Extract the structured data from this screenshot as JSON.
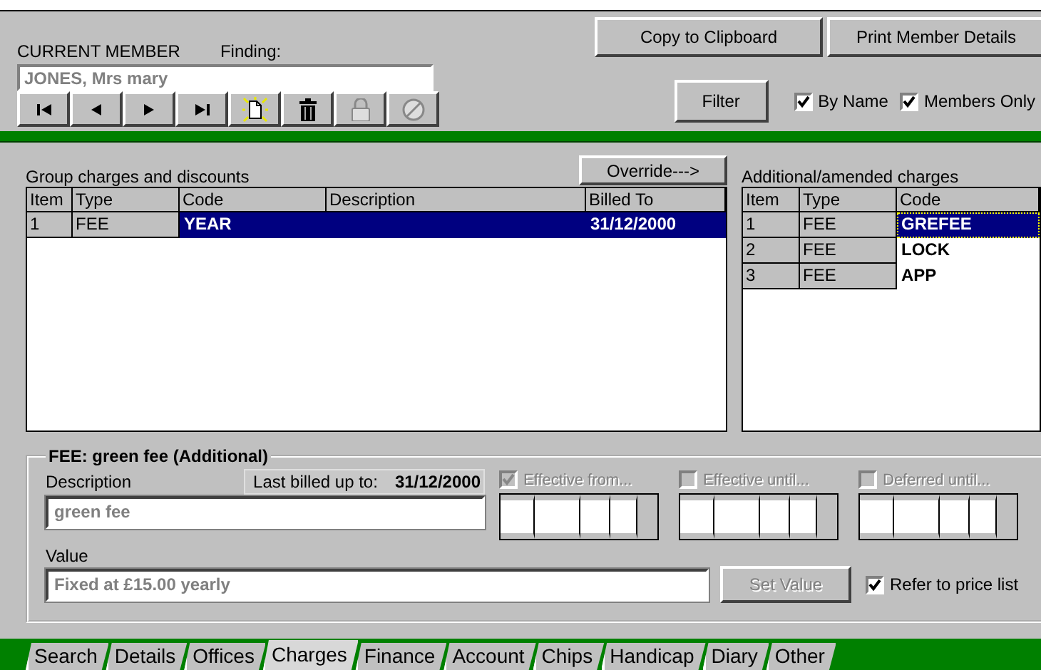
{
  "member": {
    "label": "CURRENT MEMBER",
    "finding_label": "Finding:",
    "name": "JONES, Mrs mary"
  },
  "nav_buttons": [
    {
      "kind": "first",
      "disabled": false
    },
    {
      "kind": "prev",
      "disabled": false
    },
    {
      "kind": "next",
      "disabled": false
    },
    {
      "kind": "last",
      "disabled": false
    },
    {
      "kind": "new",
      "disabled": false
    },
    {
      "kind": "delete",
      "disabled": false
    },
    {
      "kind": "lock",
      "disabled": true
    },
    {
      "kind": "cancel",
      "disabled": true
    }
  ],
  "header_buttons": [
    "Copy to Clipboard",
    "Print Member Details"
  ],
  "filter": {
    "button": "Filter",
    "options": [
      {
        "label": "By Name",
        "checked": true
      },
      {
        "label": "Members Only",
        "checked": true
      }
    ]
  },
  "group_charges": {
    "title": "Group charges and discounts",
    "override": "Override--->",
    "columns": [
      "Item",
      "Type",
      "Code",
      "Description",
      "Billed To"
    ],
    "rows": [
      {
        "item": "1",
        "type": "FEE",
        "code": "YEAR",
        "billed_to": "31/12/2000",
        "selected": true
      }
    ]
  },
  "additional": {
    "title": "Additional/amended charges",
    "columns": [
      "Item",
      "Type",
      "Code"
    ],
    "rows": [
      {
        "item": "1",
        "type": "FEE",
        "code": "GREFEE",
        "selected": true
      },
      {
        "item": "2",
        "type": "FEE",
        "code": "LOCK",
        "selected": false
      },
      {
        "item": "3",
        "type": "FEE",
        "code": "APP",
        "selected": false
      }
    ]
  },
  "detail": {
    "title": "FEE: green fee (Additional)",
    "description_label": "Description",
    "last_billed_label": "Last billed up to:",
    "last_billed": "31/12/2000",
    "description": "green fee",
    "value_label": "Value",
    "value": "Fixed at £15.00 yearly",
    "set_value": {
      "label": "Set Value",
      "disabled": true
    },
    "date_options": [
      {
        "label": "Effective from...",
        "checked": true,
        "disabled": true
      },
      {
        "label": "Effective until...",
        "checked": false,
        "disabled": true
      },
      {
        "label": "Deferred until...",
        "checked": false,
        "disabled": true
      }
    ],
    "refer": {
      "label": "Refer to price list",
      "checked": true
    }
  },
  "tabs": [
    {
      "label": "Search",
      "selected": false
    },
    {
      "label": "Details",
      "selected": false
    },
    {
      "label": "Offices",
      "selected": false
    },
    {
      "label": "Charges",
      "selected": true
    },
    {
      "label": "Finance",
      "selected": false
    },
    {
      "label": "Account",
      "selected": false
    },
    {
      "label": "Chips",
      "selected": false
    },
    {
      "label": "Handicap",
      "selected": false
    },
    {
      "label": "Diary",
      "selected": false
    },
    {
      "label": "Other",
      "selected": false
    }
  ]
}
